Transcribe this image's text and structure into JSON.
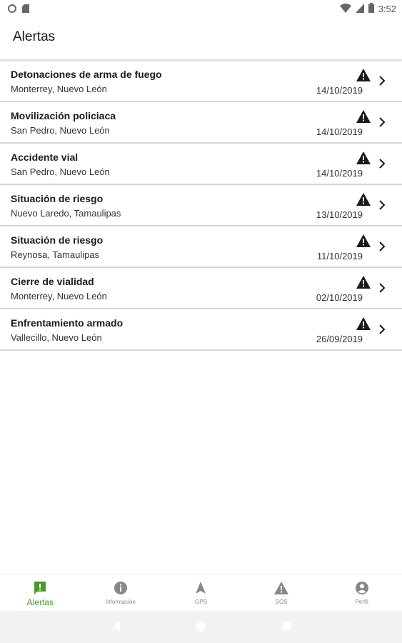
{
  "status_bar": {
    "time": "3:52"
  },
  "app_bar": {
    "title": "Alertas"
  },
  "alerts": [
    {
      "title": "Detonaciones de arma de fuego",
      "location": "Monterrey, Nuevo León",
      "date": "14/10/2019"
    },
    {
      "title": "Movilización policiaca",
      "location": "San Pedro, Nuevo León",
      "date": "14/10/2019"
    },
    {
      "title": "Accidente vial",
      "location": "San Pedro, Nuevo León",
      "date": "14/10/2019"
    },
    {
      "title": "Situación de riesgo",
      "location": "Nuevo Laredo, Tamaulipas",
      "date": "13/10/2019"
    },
    {
      "title": "Situación de riesgo",
      "location": "Reynosa, Tamaulipas",
      "date": "11/10/2019"
    },
    {
      "title": "Cierre de vialidad",
      "location": "Monterrey, Nuevo León",
      "date": "02/10/2019"
    },
    {
      "title": "Enfrentamiento armado",
      "location": "Vallecillo, Nuevo León",
      "date": "26/09/2019"
    }
  ],
  "bottom_nav": [
    {
      "label": "Alertas",
      "icon": "alert-message-icon",
      "active": true
    },
    {
      "label": "Información",
      "icon": "info-icon",
      "active": false
    },
    {
      "label": "GPS",
      "icon": "navigation-arrow-icon",
      "active": false
    },
    {
      "label": "SOS",
      "icon": "warning-icon",
      "active": false
    },
    {
      "label": "Perfil",
      "icon": "account-circle-icon",
      "active": false
    }
  ],
  "colors": {
    "accent": "#4a9a2a",
    "inactive": "#888888",
    "divider": "#d6d6d6"
  }
}
